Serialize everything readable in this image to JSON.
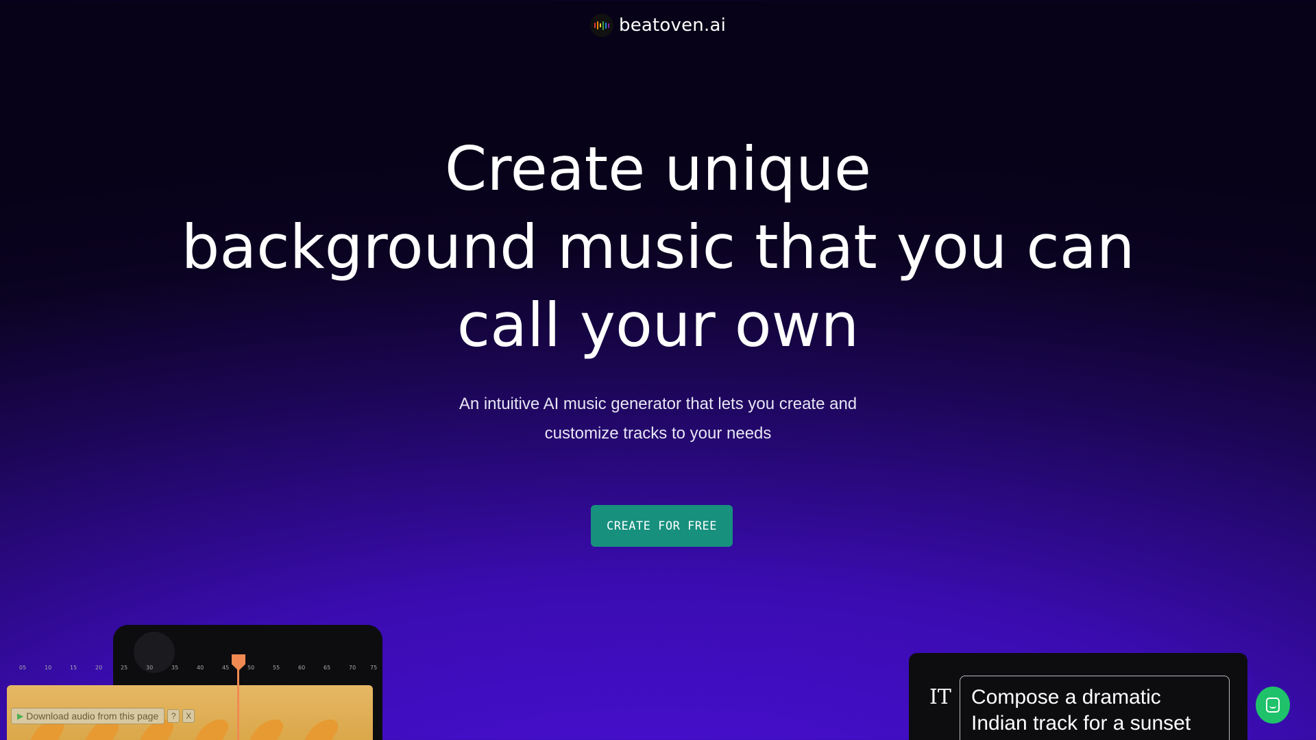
{
  "header": {
    "brand": "beatoven.ai",
    "logo_icon": "equalizer-bars-icon",
    "logo_colors": [
      "#e53935",
      "#fb8c00",
      "#fdd835",
      "#43a047",
      "#1e88e5",
      "#8e24aa"
    ]
  },
  "hero": {
    "headline_lines": [
      "Create unique",
      "background music that you can",
      "call your own"
    ],
    "subtitle_lines": [
      "An intuitive AI music generator that lets you create and",
      "customize tracks to your needs"
    ],
    "cta_label": "CREATE FOR FREE"
  },
  "editor_preview": {
    "timeline_ticks": [
      "05",
      "10",
      "15",
      "20",
      "25",
      "30",
      "35",
      "40",
      "45",
      "50",
      "55",
      "60",
      "65",
      "70",
      "75"
    ],
    "playhead_color": "#f08a52",
    "track_color": "#e6b866"
  },
  "download_bar": {
    "label": "Download audio from this page",
    "help": "?",
    "close": "X"
  },
  "prompt_preview": {
    "icon": "text-tool-icon",
    "icon_glyph": "IT",
    "prompt_text": "Compose a dramatic Indian track for a sunset scene"
  },
  "chat": {
    "icon": "chat-icon",
    "color": "#1fc26a"
  },
  "colors": {
    "cta": "#17907e",
    "background_top": "#070218",
    "background_bottom": "#4a0fd6"
  }
}
